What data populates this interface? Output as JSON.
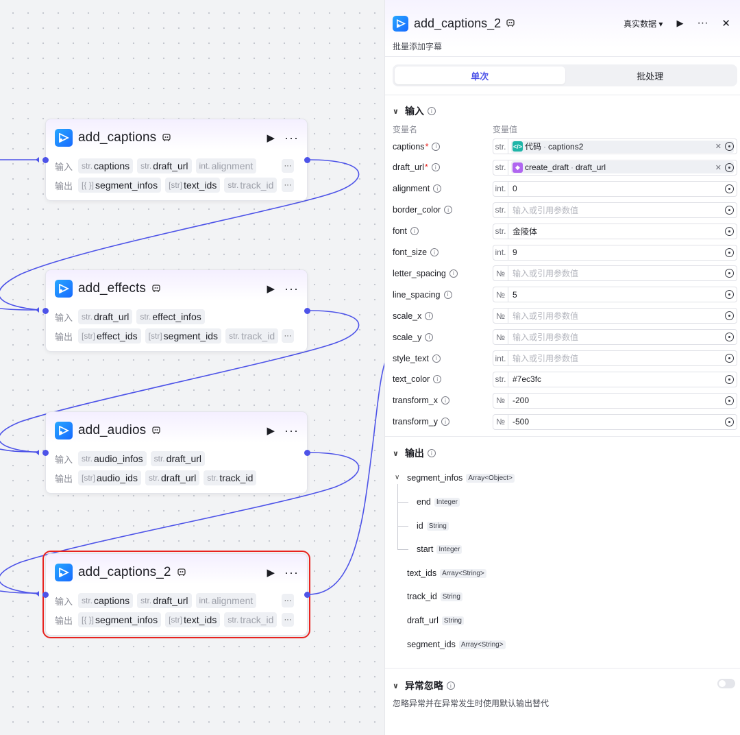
{
  "canvas": {
    "nodes": [
      {
        "title": "add_captions",
        "input_label": "输入",
        "output_label": "输出",
        "inputs": [
          {
            "type": "str.",
            "name": "captions"
          },
          {
            "type": "str.",
            "name": "draft_url"
          },
          {
            "type": "int.",
            "name": "alignment"
          }
        ],
        "outputs": [
          {
            "type": "[{ }]",
            "name": "segment_infos"
          },
          {
            "type": "[str]",
            "name": "text_ids"
          },
          {
            "type": "str.",
            "name": "track_id"
          }
        ],
        "more_inputs": "···",
        "more_outputs": "···"
      },
      {
        "title": "add_effects",
        "input_label": "输入",
        "output_label": "输出",
        "inputs": [
          {
            "type": "str.",
            "name": "draft_url"
          },
          {
            "type": "str.",
            "name": "effect_infos"
          }
        ],
        "outputs": [
          {
            "type": "[str]",
            "name": "effect_ids"
          },
          {
            "type": "[str]",
            "name": "segment_ids"
          },
          {
            "type": "str.",
            "name": "track_id"
          }
        ],
        "more_outputs": "···"
      },
      {
        "title": "add_audios",
        "input_label": "输入",
        "output_label": "输出",
        "inputs": [
          {
            "type": "str.",
            "name": "audio_infos"
          },
          {
            "type": "str.",
            "name": "draft_url"
          }
        ],
        "outputs": [
          {
            "type": "[str]",
            "name": "audio_ids"
          },
          {
            "type": "str.",
            "name": "draft_url"
          },
          {
            "type": "str.",
            "name": "track_id"
          }
        ]
      },
      {
        "title": "add_captions_2",
        "input_label": "输入",
        "output_label": "输出",
        "inputs": [
          {
            "type": "str.",
            "name": "captions"
          },
          {
            "type": "str.",
            "name": "draft_url"
          },
          {
            "type": "int.",
            "name": "alignment"
          }
        ],
        "outputs": [
          {
            "type": "[{ }]",
            "name": "segment_infos"
          },
          {
            "type": "[str]",
            "name": "text_ids"
          },
          {
            "type": "str.",
            "name": "track_id"
          }
        ],
        "more_inputs": "···",
        "more_outputs": "···"
      }
    ],
    "play_glyph": "▶",
    "more_glyph": "···"
  },
  "panel": {
    "title": "add_captions_2",
    "subtitle": "批量添加字幕",
    "data_mode": "真实数据 ▾",
    "play_glyph": "▶",
    "more_glyph": "···",
    "close_glyph": "✕",
    "tabs": [
      {
        "label": "单次",
        "active": true
      },
      {
        "label": "批处理",
        "active": false
      }
    ],
    "input_section": {
      "title": "输入",
      "col_name": "变量名",
      "col_value": "变量值",
      "rows": [
        {
          "name": "captions",
          "required": true,
          "type": "str.",
          "ref": {
            "icon": "</>",
            "icon_color": "#1fb5a8",
            "source": "代码",
            "param": "captions2"
          }
        },
        {
          "name": "draft_url",
          "required": true,
          "type": "str.",
          "ref": {
            "icon": "◆",
            "icon_color": "#b066f0",
            "source": "create_draft",
            "param": "draft_url"
          }
        },
        {
          "name": "alignment",
          "type": "int.",
          "value": "0"
        },
        {
          "name": "border_color",
          "type": "str.",
          "placeholder": "输入或引用参数值"
        },
        {
          "name": "font",
          "type": "str.",
          "value": "金陵体"
        },
        {
          "name": "font_size",
          "type": "int.",
          "value": "9"
        },
        {
          "name": "letter_spacing",
          "type": "№",
          "placeholder": "输入或引用参数值"
        },
        {
          "name": "line_spacing",
          "type": "№",
          "value": "5"
        },
        {
          "name": "scale_x",
          "type": "№",
          "placeholder": "输入或引用参数值"
        },
        {
          "name": "scale_y",
          "type": "№",
          "placeholder": "输入或引用参数值"
        },
        {
          "name": "style_text",
          "type": "int.",
          "placeholder": "输入或引用参数值"
        },
        {
          "name": "text_color",
          "type": "str.",
          "value": "#7ec3fc"
        },
        {
          "name": "transform_x",
          "type": "№",
          "value": "-200"
        },
        {
          "name": "transform_y",
          "type": "№",
          "value": "-500"
        }
      ]
    },
    "output_section": {
      "title": "输出",
      "items": [
        {
          "name": "segment_infos",
          "type": "Array<Object>",
          "expanded": true
        },
        {
          "name": "end",
          "type": "Integer",
          "child": true
        },
        {
          "name": "id",
          "type": "String",
          "child": true
        },
        {
          "name": "start",
          "type": "Integer",
          "child": true
        },
        {
          "name": "text_ids",
          "type": "Array<String>"
        },
        {
          "name": "track_id",
          "type": "String"
        },
        {
          "name": "draft_url",
          "type": "String"
        },
        {
          "name": "segment_ids",
          "type": "Array<String>"
        }
      ]
    },
    "exception_section": {
      "title": "异常忽略",
      "description": "忽略异常并在异常发生时使用默认输出替代",
      "enabled": false
    },
    "colors": {
      "accent": "#4d53e8",
      "selection": "#e8231f",
      "logo": "#1769ff"
    }
  }
}
